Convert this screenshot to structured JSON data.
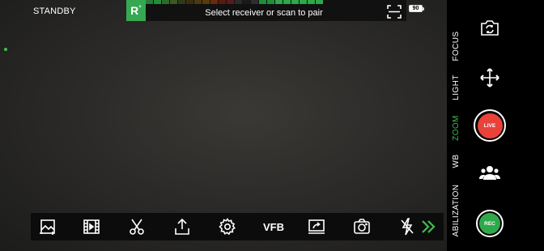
{
  "status": {
    "label": "STANDBY"
  },
  "receiver": {
    "badge": "R",
    "badge_sup": "+",
    "prompt": "Select receiver or scan to pair",
    "meter_colors": [
      "#2a7a3a",
      "#1f8f3a",
      "#2e6b2a",
      "#3b5a1f",
      "#2e3a1a",
      "#3a2e12",
      "#4a3a10",
      "#5a3a0a",
      "#6a2a0a",
      "#5a1a0a",
      "#5a1a1a",
      "#2a2a2a",
      "#1a1a1a",
      "#2e2e2e",
      "#1f8f3a",
      "#1f8f3a",
      "#2fa84a",
      "#2fa84a",
      "#2fa84a",
      "#2fa84a",
      "#2fa84a",
      "#2fa84a"
    ]
  },
  "battery": {
    "level": "90"
  },
  "toolbar": {
    "vfb_label": "VFB",
    "items": [
      "crop-icon",
      "film-icon",
      "scissors-icon",
      "share-icon",
      "gear-icon",
      "vfb",
      "screen-share-icon",
      "camera-icon",
      "flash-off-icon",
      "chevron-double-right-icon"
    ]
  },
  "sidebar": {
    "modes": [
      {
        "label": "FOCUS",
        "active": false
      },
      {
        "label": "LIGHT",
        "active": false
      },
      {
        "label": "ZOOM",
        "active": true
      },
      {
        "label": "WB",
        "active": false
      },
      {
        "label": "ABILIZATION",
        "active": false
      }
    ],
    "live_label": "LIVE",
    "rec_label": "REC",
    "accent": "#3fbf4f",
    "live_color": "#e8423b",
    "rec_color": "#2fa84a"
  }
}
